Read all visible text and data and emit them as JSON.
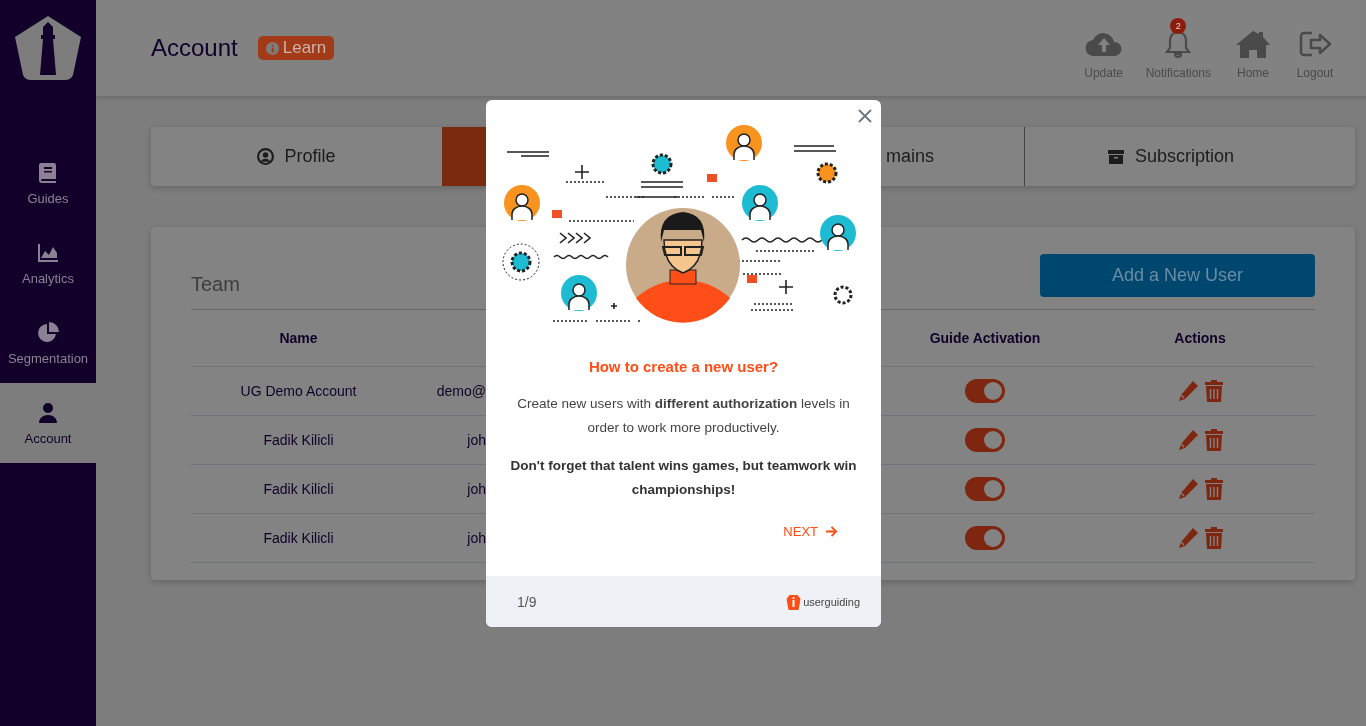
{
  "sidebar": {
    "items": [
      {
        "label": "Guides",
        "selected": false
      },
      {
        "label": "Analytics",
        "selected": false
      },
      {
        "label": "Segmentation",
        "selected": false
      },
      {
        "label": "Account",
        "selected": true
      }
    ]
  },
  "header": {
    "title": "Account",
    "learn_badge": "Learn",
    "actions": [
      {
        "label": "Update"
      },
      {
        "label": "Notifications",
        "badge": "2"
      },
      {
        "label": "Home"
      },
      {
        "label": "Logout"
      }
    ]
  },
  "tabs": [
    {
      "label": "Profile",
      "selected": false
    },
    {
      "selected": true
    },
    {
      "label": "mains",
      "selected": false
    },
    {
      "label": "Subscription",
      "selected": false
    }
  ],
  "team": {
    "title": "Team",
    "add_button": "Add a New User",
    "columns": [
      "Name",
      "Guide Activation",
      "Actions"
    ],
    "rows": [
      {
        "name": "UG Demo Account",
        "email": "demo@",
        "guide_activation": true
      },
      {
        "name": "Fadik Kilicli",
        "email": "joh",
        "guide_activation": true
      },
      {
        "name": "Fadik Kilicli",
        "email": "joh",
        "guide_activation": true
      },
      {
        "name": "Fadik Kilicli",
        "email": "joh",
        "guide_activation": true
      }
    ]
  },
  "guide_modal": {
    "title": "How to create a new user?",
    "body": "Create new users with **different authorization** levels in order to work more productively.",
    "note": "Don't forget that talent wins games, but teamwork win championships!",
    "next": "NEXT",
    "step": "1/9",
    "brand": "userguiding"
  }
}
